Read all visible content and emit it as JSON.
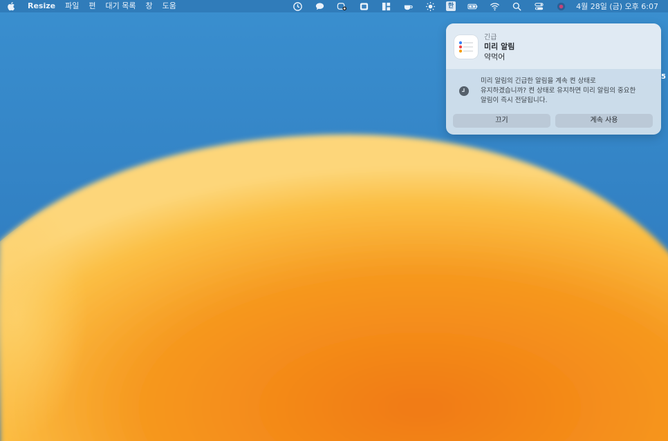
{
  "menubar": {
    "app_name": "Resize",
    "menus": [
      "파일",
      "편",
      "대기 목록",
      "창",
      "도움"
    ],
    "status_icons": [
      "time-machine-icon",
      "messages-icon",
      "screen-record-icon",
      "window-icon",
      "layout-icon",
      "teacup-icon",
      "brightness-icon"
    ],
    "keyboard_badge": "한",
    "clock": "4월 28일 (금) 오후 6:07"
  },
  "notification": {
    "category": "긴급",
    "app_title": "미리 알림",
    "body": "약먹어",
    "message_line1": "미리 알림의 긴급한 알림을 계속 켠 상태로",
    "message_line2": "유지하겠습니까? 켠 상태로 유지하면 미리 알림의 중요한",
    "message_line3": "알림이 즉시 전달됩니다.",
    "button_off": "끄기",
    "button_keep": "계속 사용"
  },
  "edge_mark": "5",
  "colors": {
    "sky": "#2b7fc2",
    "orange": "#f5921c",
    "yellow": "#fdd270"
  }
}
